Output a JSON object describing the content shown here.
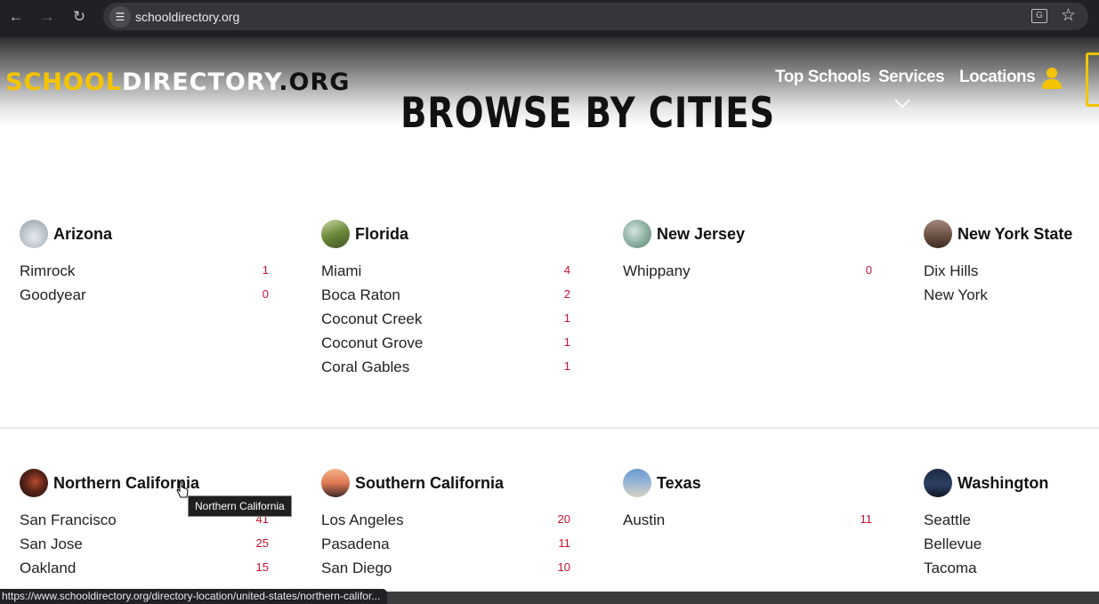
{
  "browser": {
    "url": "schooldirectory.org",
    "status_url": "https://www.schooldirectory.org/directory-location/united-states/northern-califor..."
  },
  "site": {
    "logo": {
      "part1": "SCHOOL",
      "part2": "DIRECTORY",
      "part3": ".ORG"
    },
    "nav": {
      "top_schools": "Top Schools",
      "services": "Services",
      "locations": "Locations"
    },
    "heading": "BROWSE BY CITIES"
  },
  "states": [
    {
      "name": "Arizona",
      "cities": [
        {
          "name": "Rimrock",
          "count": "1"
        },
        {
          "name": "Goodyear",
          "count": "0"
        }
      ]
    },
    {
      "name": "Florida",
      "cities": [
        {
          "name": "Miami",
          "count": "4"
        },
        {
          "name": "Boca Raton",
          "count": "2"
        },
        {
          "name": "Coconut Creek",
          "count": "1"
        },
        {
          "name": "Coconut Grove",
          "count": "1"
        },
        {
          "name": "Coral Gables",
          "count": "1"
        }
      ]
    },
    {
      "name": "New Jersey",
      "cities": [
        {
          "name": "Whippany",
          "count": "0"
        }
      ]
    },
    {
      "name": "New York State",
      "cities": [
        {
          "name": "Dix Hills",
          "count": ""
        },
        {
          "name": "New York",
          "count": ""
        }
      ]
    },
    {
      "name": "Northern California",
      "cities": [
        {
          "name": "San Francisco",
          "count": "41"
        },
        {
          "name": "San Jose",
          "count": "25"
        },
        {
          "name": "Oakland",
          "count": "15"
        }
      ]
    },
    {
      "name": "Southern California",
      "cities": [
        {
          "name": "Los Angeles",
          "count": "20"
        },
        {
          "name": "Pasadena",
          "count": "11"
        },
        {
          "name": "San Diego",
          "count": "10"
        }
      ]
    },
    {
      "name": "Texas",
      "cities": [
        {
          "name": "Austin",
          "count": "11"
        }
      ]
    },
    {
      "name": "Washington",
      "cities": [
        {
          "name": "Seattle",
          "count": ""
        },
        {
          "name": "Bellevue",
          "count": ""
        },
        {
          "name": "Tacoma",
          "count": ""
        }
      ]
    }
  ],
  "tooltip": "Northern California",
  "colors": {
    "brand_yellow": "#f5c400",
    "count_red": "#c8102e"
  }
}
